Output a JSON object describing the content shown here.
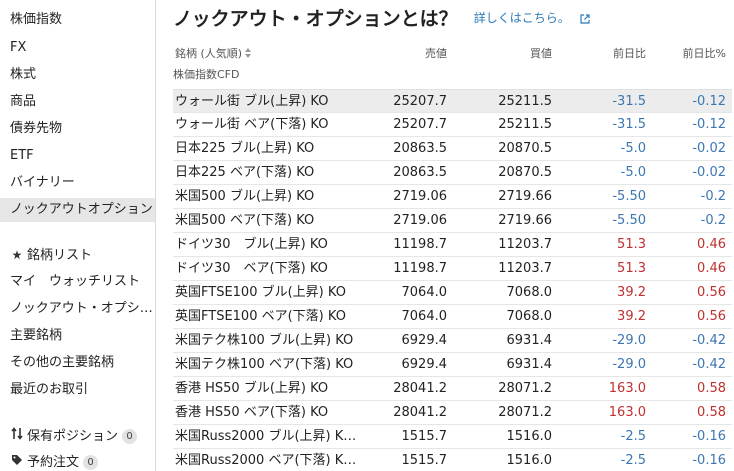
{
  "sidebar": {
    "categories": [
      {
        "label": "株価指数"
      },
      {
        "label": "FX"
      },
      {
        "label": "株式"
      },
      {
        "label": "商品"
      },
      {
        "label": "債券先物"
      },
      {
        "label": "ETF"
      },
      {
        "label": "バイナリー"
      },
      {
        "label": "ノックアウトオプション"
      }
    ],
    "lists": [
      {
        "label": "銘柄リスト",
        "icon": "star-icon"
      },
      {
        "label": "マイ　ウォッチリスト"
      },
      {
        "label": "ノックアウト・オプシ…"
      },
      {
        "label": "主要銘柄"
      },
      {
        "label": "その他の主要銘柄"
      },
      {
        "label": "最近のお取引"
      }
    ],
    "account": [
      {
        "label": "保有ポジション",
        "count": "0",
        "icon": "positions-icon"
      },
      {
        "label": "予約注文",
        "count": "0",
        "icon": "tag-icon"
      }
    ]
  },
  "header": {
    "title": "ノックアウト・オプションとは？",
    "link": "詳しくはこちら。"
  },
  "table": {
    "columns": {
      "name": "銘柄 (人気順)",
      "bid": "売値",
      "ask": "買値",
      "change": "前日比",
      "change_pct": "前日比%"
    },
    "group": "株価指数CFD",
    "rows": [
      {
        "name": "ウォール街 ブル(上昇) KO",
        "bid": "25207.7",
        "ask": "25211.5",
        "change": "-31.5",
        "pct": "-0.12"
      },
      {
        "name": "ウォール街 ベア(下落) KO",
        "bid": "25207.7",
        "ask": "25211.5",
        "change": "-31.5",
        "pct": "-0.12"
      },
      {
        "name": "日本225 ブル(上昇) KO",
        "bid": "20863.5",
        "ask": "20870.5",
        "change": "-5.0",
        "pct": "-0.02"
      },
      {
        "name": "日本225 ベア(下落) KO",
        "bid": "20863.5",
        "ask": "20870.5",
        "change": "-5.0",
        "pct": "-0.02"
      },
      {
        "name": "米国500 ブル(上昇) KO",
        "bid": "2719.06",
        "ask": "2719.66",
        "change": "-5.50",
        "pct": "-0.2"
      },
      {
        "name": "米国500 ベア(下落) KO",
        "bid": "2719.06",
        "ask": "2719.66",
        "change": "-5.50",
        "pct": "-0.2"
      },
      {
        "name": "ドイツ30　ブル(上昇) KO",
        "bid": "11198.7",
        "ask": "11203.7",
        "change": "51.3",
        "pct": "0.46"
      },
      {
        "name": "ドイツ30　ベア(下落) KO",
        "bid": "11198.7",
        "ask": "11203.7",
        "change": "51.3",
        "pct": "0.46"
      },
      {
        "name": "英国FTSE100 ブル(上昇) KO",
        "bid": "7064.0",
        "ask": "7068.0",
        "change": "39.2",
        "pct": "0.56"
      },
      {
        "name": "英国FTSE100 ベア(下落) KO",
        "bid": "7064.0",
        "ask": "7068.0",
        "change": "39.2",
        "pct": "0.56"
      },
      {
        "name": "米国テク株100 ブル(上昇) KO",
        "bid": "6929.4",
        "ask": "6931.4",
        "change": "-29.0",
        "pct": "-0.42"
      },
      {
        "name": "米国テク株100 ベア(下落) KO",
        "bid": "6929.4",
        "ask": "6931.4",
        "change": "-29.0",
        "pct": "-0.42"
      },
      {
        "name": "香港 HS50 ブル(上昇) KO",
        "bid": "28041.2",
        "ask": "28071.2",
        "change": "163.0",
        "pct": "0.58"
      },
      {
        "name": "香港 HS50 ベア(下落) KO",
        "bid": "28041.2",
        "ask": "28071.2",
        "change": "163.0",
        "pct": "0.58"
      },
      {
        "name": "米国Russ2000 ブル(上昇) K…",
        "bid": "1515.7",
        "ask": "1516.0",
        "change": "-2.5",
        "pct": "-0.16"
      },
      {
        "name": "米国Russ2000 ベア(下落) K…",
        "bid": "1515.7",
        "ask": "1516.0",
        "change": "-2.5",
        "pct": "-0.16"
      }
    ]
  },
  "colors": {
    "negative": "#3d77b0",
    "positive": "#c03030",
    "link": "#2a7ab8",
    "active_bg": "#e6e6e6"
  }
}
